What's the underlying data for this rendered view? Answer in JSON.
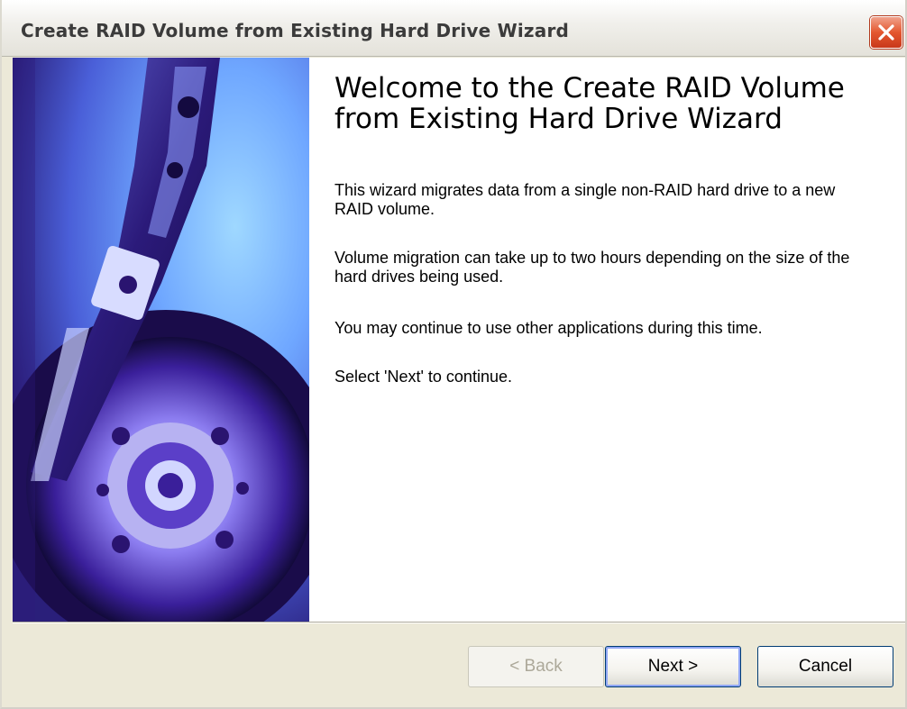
{
  "window": {
    "title": "Create RAID Volume from Existing Hard Drive Wizard",
    "close_icon": "close-icon"
  },
  "content": {
    "heading": "Welcome to the Create RAID Volume from Existing Hard Drive Wizard",
    "paragraphs": [
      "This wizard migrates data from a single non-RAID hard drive to a new RAID volume.",
      "Volume migration can take up to two hours depending on the size of the hard drives being used.",
      "You may continue to use other applications during this time.",
      "Select 'Next' to continue."
    ]
  },
  "buttons": {
    "back": "< Back",
    "next": "Next >",
    "cancel": "Cancel"
  },
  "colors": {
    "close_button": "#e4572f",
    "image_tint": "#6a8cf0"
  }
}
